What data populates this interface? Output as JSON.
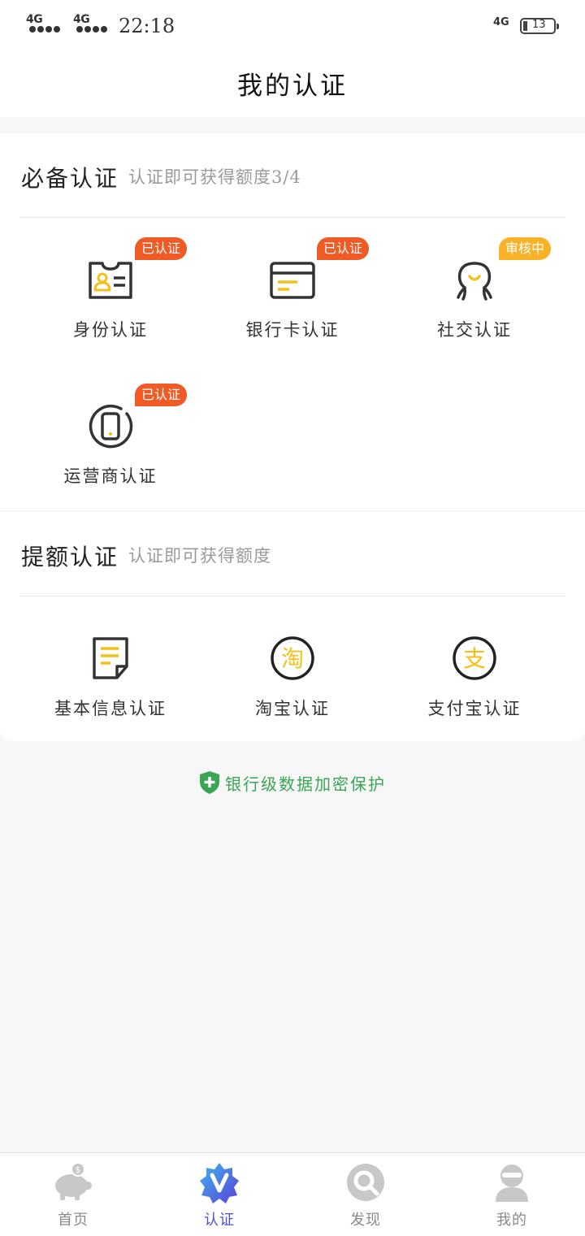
{
  "status_bar": {
    "signal1": "4G",
    "signal2": "4G",
    "time": "22:18",
    "network": "4G",
    "battery": "13"
  },
  "header": {
    "title": "我的认证"
  },
  "required_section": {
    "title": "必备认证",
    "subtitle": "认证即可获得额度3/4",
    "items": [
      {
        "label": "身份认证",
        "badge": "已认证",
        "badge_status": "done",
        "icon": "id-card-icon"
      },
      {
        "label": "银行卡认证",
        "badge": "已认证",
        "badge_status": "done",
        "icon": "bank-card-icon"
      },
      {
        "label": "社交认证",
        "badge": "审核中",
        "badge_status": "review",
        "icon": "social-icon"
      },
      {
        "label": "运营商认证",
        "badge": "已认证",
        "badge_status": "done",
        "icon": "phone-icon"
      }
    ]
  },
  "boost_section": {
    "title": "提额认证",
    "subtitle": "认证即可获得额度",
    "items": [
      {
        "label": "基本信息认证",
        "icon": "document-icon"
      },
      {
        "label": "淘宝认证",
        "icon": "taobao-icon",
        "glyph": "淘"
      },
      {
        "label": "支付宝认证",
        "icon": "alipay-icon",
        "glyph": "支"
      }
    ]
  },
  "security_note": {
    "text": "银行级数据加密保护"
  },
  "tabbar": {
    "tabs": [
      {
        "label": "首页",
        "icon": "piggy-bank-icon"
      },
      {
        "label": "认证",
        "icon": "verify-v-icon",
        "active": true
      },
      {
        "label": "发现",
        "icon": "discover-icon"
      },
      {
        "label": "我的",
        "icon": "profile-icon"
      }
    ]
  },
  "colors": {
    "badge_done": "#f05a24",
    "badge_review": "#f7b227",
    "icon_accent": "#f5c019",
    "security_green": "#3aa655",
    "tab_active": "#4a4fd6"
  }
}
